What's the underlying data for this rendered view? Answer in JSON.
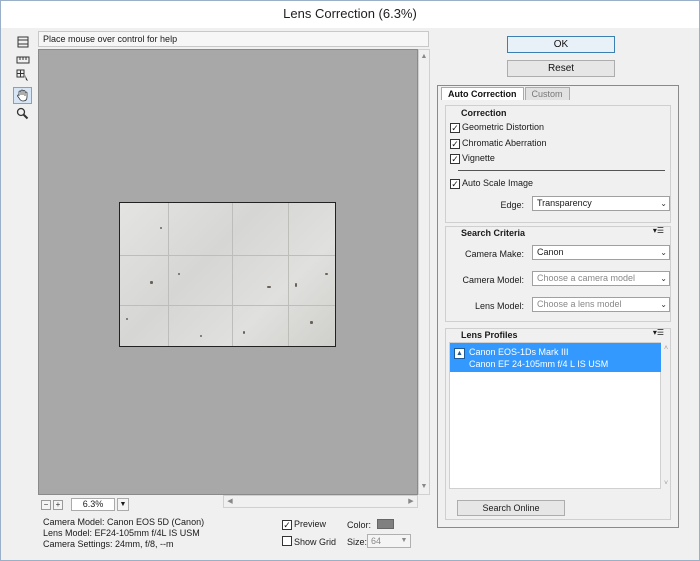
{
  "window": {
    "title": "Lens Correction (6.3%)"
  },
  "toolbar": {
    "tools": [
      "remove-distortion-tool",
      "move-grid-tool",
      "move-image-tool",
      "hand-tool",
      "zoom-tool"
    ]
  },
  "hint": "Place mouse over control for help",
  "zoom": {
    "value": "6.3%",
    "minus": "−",
    "plus": "+"
  },
  "camera_info": {
    "line1": "Camera Model: Canon EOS 5D (Canon)",
    "line2": "Lens Model: EF24-105mm f/4L IS USM",
    "line3": "Camera Settings: 24mm, f/8, --m"
  },
  "bottom_options": {
    "preview_label": "Preview",
    "preview_checked": true,
    "show_grid_label": "Show Grid",
    "show_grid_checked": false,
    "color_label": "Color:",
    "color_value": "#808080",
    "size_label": "Size:",
    "size_value": "64"
  },
  "buttons": {
    "ok": "OK",
    "reset": "Reset"
  },
  "tabs": [
    {
      "label": "Auto Correction",
      "active": true
    },
    {
      "label": "Custom",
      "active": false
    }
  ],
  "correction": {
    "title": "Correction",
    "geometric_distortion": "Geometric Distortion",
    "chromatic_aberration": "Chromatic Aberration",
    "vignette": "Vignette",
    "auto_scale": "Auto Scale Image",
    "edge_label": "Edge:",
    "edge_value": "Transparency"
  },
  "search_criteria": {
    "title": "Search Criteria",
    "camera_make_label": "Camera Make:",
    "camera_make_value": "Canon",
    "camera_model_label": "Camera Model:",
    "camera_model_placeholder": "Choose a camera model",
    "lens_model_label": "Lens Model:",
    "lens_model_placeholder": "Choose a lens model"
  },
  "lens_profiles": {
    "title": "Lens Profiles",
    "selected_line1": "Canon EOS-1Ds Mark III",
    "selected_line2": "Canon EF 24-105mm f/4 L IS USM",
    "search_online": "Search Online"
  },
  "colors": {
    "accent": "#3399ff",
    "canvas": "#a8a8a8"
  }
}
